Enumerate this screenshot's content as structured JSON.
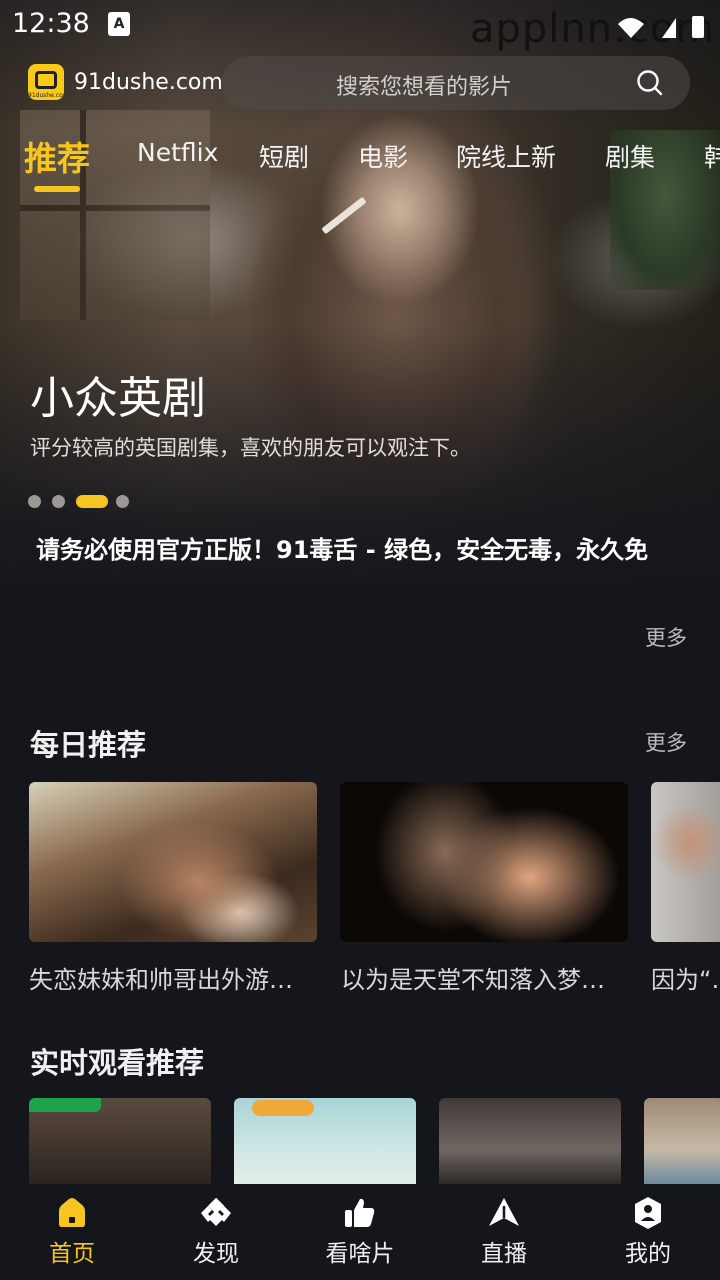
{
  "status_bar": {
    "time": "12:38",
    "badge_letter": "A",
    "watermark": "applnn.com"
  },
  "header": {
    "site": "91dushe.com",
    "logo_label": "91dushe.com",
    "search_placeholder": "搜索您想看的影片"
  },
  "tabs": [
    "推荐",
    "Netflix",
    "短剧",
    "电影",
    "院线上新",
    "剧集",
    "韩"
  ],
  "active_tab": 0,
  "banner": {
    "title": "小众英剧",
    "description": "评分较高的英国剧集，喜欢的朋友可以观注下。",
    "dot_count": 4,
    "active_dot": 2
  },
  "notice": "请务必使用官方正版！91毒舌 - 绿色，安全无毒，永久免",
  "more_label": "更多",
  "daily": {
    "title": "每日推荐",
    "more": "更多",
    "items": [
      {
        "caption": "失恋妹妹和帅哥出外游…"
      },
      {
        "caption": "以为是天堂不知落入梦…"
      },
      {
        "caption": "因为“…"
      }
    ]
  },
  "realtime": {
    "title": "实时观看推荐"
  },
  "bottom_nav": [
    {
      "label": "首页",
      "icon": "home-icon",
      "active": true
    },
    {
      "label": "发现",
      "icon": "discover-icon",
      "active": false
    },
    {
      "label": "看啥片",
      "icon": "thumbs-up-icon",
      "active": false
    },
    {
      "label": "直播",
      "icon": "live-icon",
      "active": false
    },
    {
      "label": "我的",
      "icon": "profile-icon",
      "active": false
    }
  ],
  "colors": {
    "accent": "#f6c520",
    "background": "#15161c"
  }
}
